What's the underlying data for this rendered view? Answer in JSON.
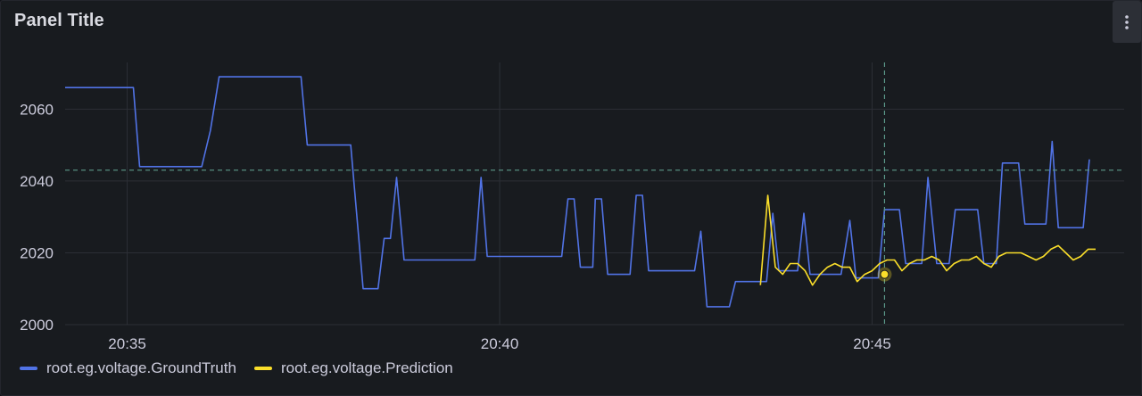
{
  "panel": {
    "title": "Panel Title",
    "menu_icon": "more-vertical-icon"
  },
  "colors": {
    "background": "#181b1f",
    "grid": "#2c2f36",
    "axis_text": "#ccccdc",
    "crosshair": "#5c9a8a",
    "ground_truth": "#5173e6",
    "prediction": "#fade2a"
  },
  "chart_data": {
    "type": "line",
    "title": "",
    "xlabel": "",
    "ylabel": "",
    "xlim": [
      "20:34:10",
      "20:48:23"
    ],
    "ylim": [
      2000,
      2073
    ],
    "x_ticks": [
      "20:35",
      "20:40",
      "20:45"
    ],
    "y_ticks": [
      2000,
      2020,
      2040,
      2060
    ],
    "legend_position": "bottom-left",
    "grid": true,
    "crosshair": {
      "x": "20:45:10",
      "y": 2043,
      "highlight_y": 2014,
      "highlight_series": "root.eg.voltage.Prediction"
    },
    "series": [
      {
        "name": "root.eg.voltage.GroundTruth",
        "color": "#5173e6",
        "points": [
          [
            "20:34:10",
            2066
          ],
          [
            "20:35:05",
            2066
          ],
          [
            "20:35:10",
            2044
          ],
          [
            "20:36:00",
            2044
          ],
          [
            "20:36:07",
            2054
          ],
          [
            "20:36:14",
            2069
          ],
          [
            "20:37:20",
            2069
          ],
          [
            "20:37:25",
            2050
          ],
          [
            "20:38:00",
            2050
          ],
          [
            "20:38:10",
            2010
          ],
          [
            "20:38:22",
            2010
          ],
          [
            "20:38:27",
            2024
          ],
          [
            "20:38:32",
            2024
          ],
          [
            "20:38:37",
            2041
          ],
          [
            "20:38:43",
            2018
          ],
          [
            "20:39:40",
            2018
          ],
          [
            "20:39:45",
            2041
          ],
          [
            "20:39:50",
            2019
          ],
          [
            "20:40:50",
            2019
          ],
          [
            "20:40:55",
            2035
          ],
          [
            "20:41:00",
            2035
          ],
          [
            "20:41:05",
            2016
          ],
          [
            "20:41:15",
            2016
          ],
          [
            "20:41:17",
            2035
          ],
          [
            "20:41:22",
            2035
          ],
          [
            "20:41:27",
            2014
          ],
          [
            "20:41:45",
            2014
          ],
          [
            "20:41:50",
            2036
          ],
          [
            "20:41:55",
            2036
          ],
          [
            "20:42:00",
            2015
          ],
          [
            "20:42:37",
            2015
          ],
          [
            "20:42:42",
            2026
          ],
          [
            "20:42:47",
            2005
          ],
          [
            "20:43:05",
            2005
          ],
          [
            "20:43:10",
            2012
          ],
          [
            "20:43:35",
            2012
          ],
          [
            "20:43:40",
            2031
          ],
          [
            "20:43:45",
            2015
          ],
          [
            "20:44:00",
            2015
          ],
          [
            "20:44:05",
            2031
          ],
          [
            "20:44:10",
            2014
          ],
          [
            "20:44:35",
            2014
          ],
          [
            "20:44:42",
            2029
          ],
          [
            "20:44:47",
            2013
          ],
          [
            "20:45:05",
            2013
          ],
          [
            "20:45:10",
            2032
          ],
          [
            "20:45:22",
            2032
          ],
          [
            "20:45:27",
            2017
          ],
          [
            "20:45:40",
            2017
          ],
          [
            "20:45:45",
            2041
          ],
          [
            "20:45:52",
            2017
          ],
          [
            "20:46:02",
            2017
          ],
          [
            "20:46:07",
            2032
          ],
          [
            "20:46:25",
            2032
          ],
          [
            "20:46:30",
            2017
          ],
          [
            "20:46:40",
            2017
          ],
          [
            "20:46:45",
            2045
          ],
          [
            "20:46:58",
            2045
          ],
          [
            "20:47:03",
            2028
          ],
          [
            "20:47:20",
            2028
          ],
          [
            "20:47:25",
            2051
          ],
          [
            "20:47:30",
            2027
          ],
          [
            "20:47:50",
            2027
          ],
          [
            "20:47:55",
            2046
          ]
        ]
      },
      {
        "name": "root.eg.voltage.Prediction",
        "color": "#fade2a",
        "points": [
          [
            "20:43:30",
            2011
          ],
          [
            "20:43:36",
            2036
          ],
          [
            "20:43:42",
            2016
          ],
          [
            "20:43:48",
            2014
          ],
          [
            "20:43:54",
            2017
          ],
          [
            "20:44:00",
            2017
          ],
          [
            "20:44:06",
            2015
          ],
          [
            "20:44:12",
            2011
          ],
          [
            "20:44:18",
            2014
          ],
          [
            "20:44:24",
            2016
          ],
          [
            "20:44:30",
            2017
          ],
          [
            "20:44:36",
            2016
          ],
          [
            "20:44:42",
            2016
          ],
          [
            "20:44:48",
            2012
          ],
          [
            "20:44:54",
            2014
          ],
          [
            "20:45:00",
            2015
          ],
          [
            "20:45:06",
            2017
          ],
          [
            "20:45:12",
            2018
          ],
          [
            "20:45:18",
            2018
          ],
          [
            "20:45:24",
            2015
          ],
          [
            "20:45:30",
            2017
          ],
          [
            "20:45:36",
            2018
          ],
          [
            "20:45:42",
            2018
          ],
          [
            "20:45:48",
            2019
          ],
          [
            "20:45:54",
            2018
          ],
          [
            "20:46:00",
            2015
          ],
          [
            "20:46:06",
            2017
          ],
          [
            "20:46:12",
            2018
          ],
          [
            "20:46:18",
            2018
          ],
          [
            "20:46:24",
            2019
          ],
          [
            "20:46:30",
            2017
          ],
          [
            "20:46:36",
            2016
          ],
          [
            "20:46:42",
            2019
          ],
          [
            "20:46:48",
            2020
          ],
          [
            "20:46:54",
            2020
          ],
          [
            "20:47:00",
            2020
          ],
          [
            "20:47:06",
            2019
          ],
          [
            "20:47:12",
            2018
          ],
          [
            "20:47:18",
            2019
          ],
          [
            "20:47:24",
            2021
          ],
          [
            "20:47:30",
            2022
          ],
          [
            "20:47:36",
            2020
          ],
          [
            "20:47:42",
            2018
          ],
          [
            "20:47:48",
            2019
          ],
          [
            "20:47:54",
            2021
          ],
          [
            "20:48:00",
            2021
          ]
        ]
      }
    ]
  }
}
